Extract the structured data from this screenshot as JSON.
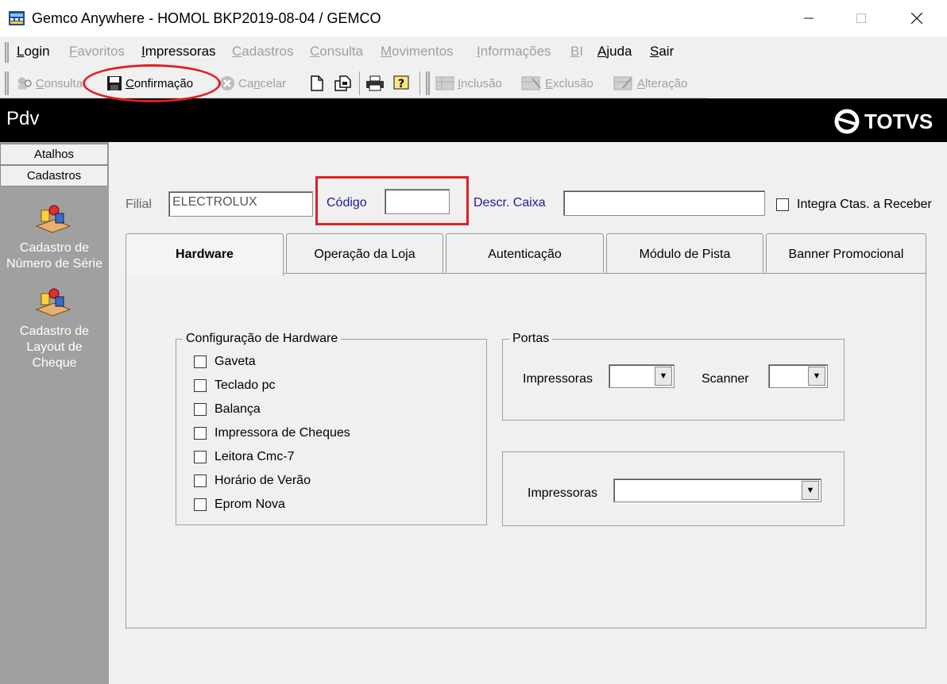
{
  "window": {
    "title": "Gemco Anywhere - HOMOL BKP2019-08-04 / GEMCO"
  },
  "menu": {
    "items": [
      {
        "label": "Login",
        "u": "L",
        "rest": "ogin",
        "enabled": true
      },
      {
        "label": "Favoritos",
        "u": "F",
        "rest": "avoritos",
        "enabled": false
      },
      {
        "label": "Impressoras",
        "u": "I",
        "rest": "mpressoras",
        "enabled": true
      },
      {
        "label": "Cadastros",
        "u": "C",
        "rest": "adastros",
        "enabled": false
      },
      {
        "label": "Consulta",
        "u": "C",
        "rest": "onsulta",
        "enabled": false
      },
      {
        "label": "Movimentos",
        "u": "M",
        "rest": "ovimentos",
        "enabled": false
      },
      {
        "label": "Informações",
        "u": "I",
        "rest": "nformações",
        "enabled": false
      },
      {
        "label": "BI",
        "u": "B",
        "rest": "I",
        "enabled": false
      },
      {
        "label": "Ajuda",
        "u": "A",
        "rest": "juda",
        "enabled": true
      },
      {
        "label": "Sair",
        "u": "S",
        "rest": "air",
        "enabled": true
      }
    ]
  },
  "toolbar": {
    "consulta": {
      "u": "C",
      "rest": "onsulta"
    },
    "confirmacao": {
      "u": "C",
      "rest": "onfirmação"
    },
    "cancelar": {
      "pre": "Ca",
      "u": "n",
      "rest": "celar"
    },
    "inclusao": {
      "u": "I",
      "rest": "nclusão"
    },
    "exclusao": {
      "u": "E",
      "rest": "xclusão"
    },
    "alteracao": {
      "u": "A",
      "rest": "lteração"
    }
  },
  "header": {
    "title": "Pdv",
    "logo_text": "TOTVS"
  },
  "left_panel": {
    "buttons": [
      "Atalhos",
      "Cadastros"
    ],
    "items": [
      {
        "line1": "Cadastro de",
        "line2": "Número de Série",
        "line3": ""
      },
      {
        "line1": "Cadastro de",
        "line2": "Layout de",
        "line3": "Cheque"
      }
    ]
  },
  "form": {
    "filial_label": "Filial",
    "filial_value": "ELECTROLUX",
    "codigo_label": "Código",
    "codigo_value": "",
    "descr_label": "Descr. Caixa",
    "descr_value": "",
    "integra_label": "Integra Ctas. a Receber"
  },
  "tabs": [
    "Hardware",
    "Operação da Loja",
    "Autenticação",
    "Módulo de Pista",
    "Banner Promocional"
  ],
  "hardware": {
    "group_title": "Configuração de Hardware",
    "options": [
      "Gaveta",
      "Teclado pc",
      "Balança",
      "Impressora de Cheques",
      "Leitora Cmc-7",
      "Horário de Verão",
      "Eprom Nova"
    ]
  },
  "portas": {
    "group_title": "Portas",
    "impressoras_label": "Impressoras",
    "scanner_label": "Scanner",
    "impressoras_value": "",
    "scanner_value": ""
  },
  "printer_group": {
    "impressoras_label": "Impressoras",
    "value": ""
  },
  "colors": {
    "annotation": "#e02020",
    "header_bg": "#000000",
    "side_panel": "#a0a0a0",
    "label_blue": "#1c1c9c"
  }
}
